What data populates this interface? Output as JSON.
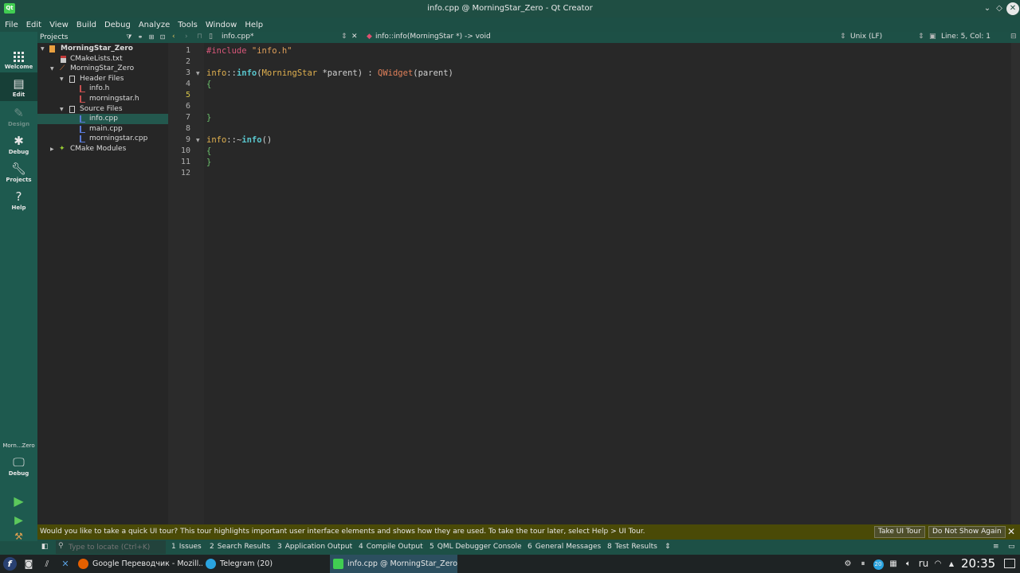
{
  "window": {
    "title": "info.cpp @ MorningStar_Zero - Qt Creator",
    "app_icon": "qt-logo",
    "controls": [
      "chevron-down-icon",
      "restore-icon",
      "close-icon"
    ]
  },
  "menu": [
    "File",
    "Edit",
    "View",
    "Build",
    "Debug",
    "Analyze",
    "Tools",
    "Window",
    "Help"
  ],
  "modes": [
    {
      "label": "Welcome",
      "icon": "grid-icon"
    },
    {
      "label": "Edit",
      "icon": "document-icon",
      "active": true
    },
    {
      "label": "Design",
      "icon": "pen-icon",
      "disabled": true
    },
    {
      "label": "Debug",
      "icon": "bug-icon"
    },
    {
      "label": "Projects",
      "icon": "wrench-icon"
    },
    {
      "label": "Help",
      "icon": "question-icon"
    }
  ],
  "kit": {
    "project": "Morn...Zero",
    "config": "Debug"
  },
  "projects_pane": {
    "title": "Projects",
    "tree": [
      {
        "label": "MorningStar_Zero",
        "bold": true
      },
      {
        "label": "CMakeLists.txt"
      },
      {
        "label": "MorningStar_Zero"
      },
      {
        "label": "Header Files"
      },
      {
        "label": "info.h"
      },
      {
        "label": "morningstar.h"
      },
      {
        "label": "Source Files"
      },
      {
        "label": "info.cpp",
        "selected": true
      },
      {
        "label": "main.cpp"
      },
      {
        "label": "morningstar.cpp"
      },
      {
        "label": "CMake Modules"
      }
    ]
  },
  "editor": {
    "file_tab": "info.cpp*",
    "symbol": "info::info(MorningStar *) -> void",
    "line_ending": "Unix (LF)",
    "position": "Line: 5, Col: 1",
    "current_line": 5,
    "lines": [
      {
        "n": "1",
        "tokens": [
          {
            "t": "#include ",
            "c": "#d8577a"
          },
          {
            "t": "\"info.h\"",
            "c": "#e0a05a"
          }
        ]
      },
      {
        "n": "2",
        "tokens": []
      },
      {
        "n": "3",
        "tokens": [
          {
            "t": "info",
            "c": "#e0b04f"
          },
          {
            "t": "::",
            "c": "#d0d0d0"
          },
          {
            "t": "info",
            "c": "#59c7ce"
          },
          {
            "t": "(",
            "c": "#d0d0d0"
          },
          {
            "t": "MorningStar",
            "c": "#e0b04f"
          },
          {
            "t": " *",
            "c": "#d0d0d0"
          },
          {
            "t": "parent",
            "c": "#d0d0d0"
          },
          {
            "t": ") : ",
            "c": "#d0d0d0"
          },
          {
            "t": "QWidget",
            "c": "#e0805a"
          },
          {
            "t": "(",
            "c": "#d0d0d0"
          },
          {
            "t": "parent",
            "c": "#d0d0d0"
          },
          {
            "t": ")",
            "c": "#d0d0d0"
          }
        ]
      },
      {
        "n": "4",
        "tokens": [
          {
            "t": "{",
            "c": "#6cc06c"
          }
        ]
      },
      {
        "n": "5",
        "tokens": []
      },
      {
        "n": "6",
        "tokens": []
      },
      {
        "n": "7",
        "tokens": [
          {
            "t": "}",
            "c": "#6cc06c"
          }
        ]
      },
      {
        "n": "8",
        "tokens": []
      },
      {
        "n": "9",
        "tokens": [
          {
            "t": "info",
            "c": "#e0b04f"
          },
          {
            "t": "::~",
            "c": "#d0d0d0"
          },
          {
            "t": "info",
            "c": "#59c7ce"
          },
          {
            "t": "()",
            "c": "#d0d0d0"
          }
        ]
      },
      {
        "n": "10",
        "tokens": [
          {
            "t": "{",
            "c": "#6cc06c"
          }
        ]
      },
      {
        "n": "11",
        "tokens": [
          {
            "t": "}",
            "c": "#6cc06c"
          }
        ]
      },
      {
        "n": "12",
        "tokens": []
      }
    ]
  },
  "info_bar": {
    "message": "Would you like to take a quick UI tour? This tour highlights important user interface elements and shows how they are used. To take the tour later, select Help > UI Tour.",
    "primary": "Take UI Tour",
    "secondary": "Do Not Show Again"
  },
  "locator": {
    "placeholder": "Type to locate (Ctrl+K)"
  },
  "output_panes": [
    {
      "num": "1",
      "label": "Issues"
    },
    {
      "num": "2",
      "label": "Search Results"
    },
    {
      "num": "3",
      "label": "Application Output"
    },
    {
      "num": "4",
      "label": "Compile Output"
    },
    {
      "num": "5",
      "label": "QML Debugger Console"
    },
    {
      "num": "6",
      "label": "General Messages"
    },
    {
      "num": "8",
      "label": "Test Results"
    }
  ],
  "taskbar": {
    "tasks": [
      {
        "label": "Google Переводчик - Mozill...",
        "icon": "firefox-icon",
        "color": "#e66000"
      },
      {
        "label": "Telegram (20)",
        "icon": "telegram-icon",
        "color": "#2aa3df"
      },
      {
        "label": "info.cpp @ MorningStar_Zero...",
        "icon": "qt-icon",
        "color": "#41cd52",
        "active": true
      }
    ],
    "tray": {
      "badge": "20",
      "language": "ru"
    },
    "clock": "20:35"
  },
  "colors": {
    "accent": "#1e5a4f",
    "selection": "#23584e",
    "info_bar": "#4a4a07"
  }
}
